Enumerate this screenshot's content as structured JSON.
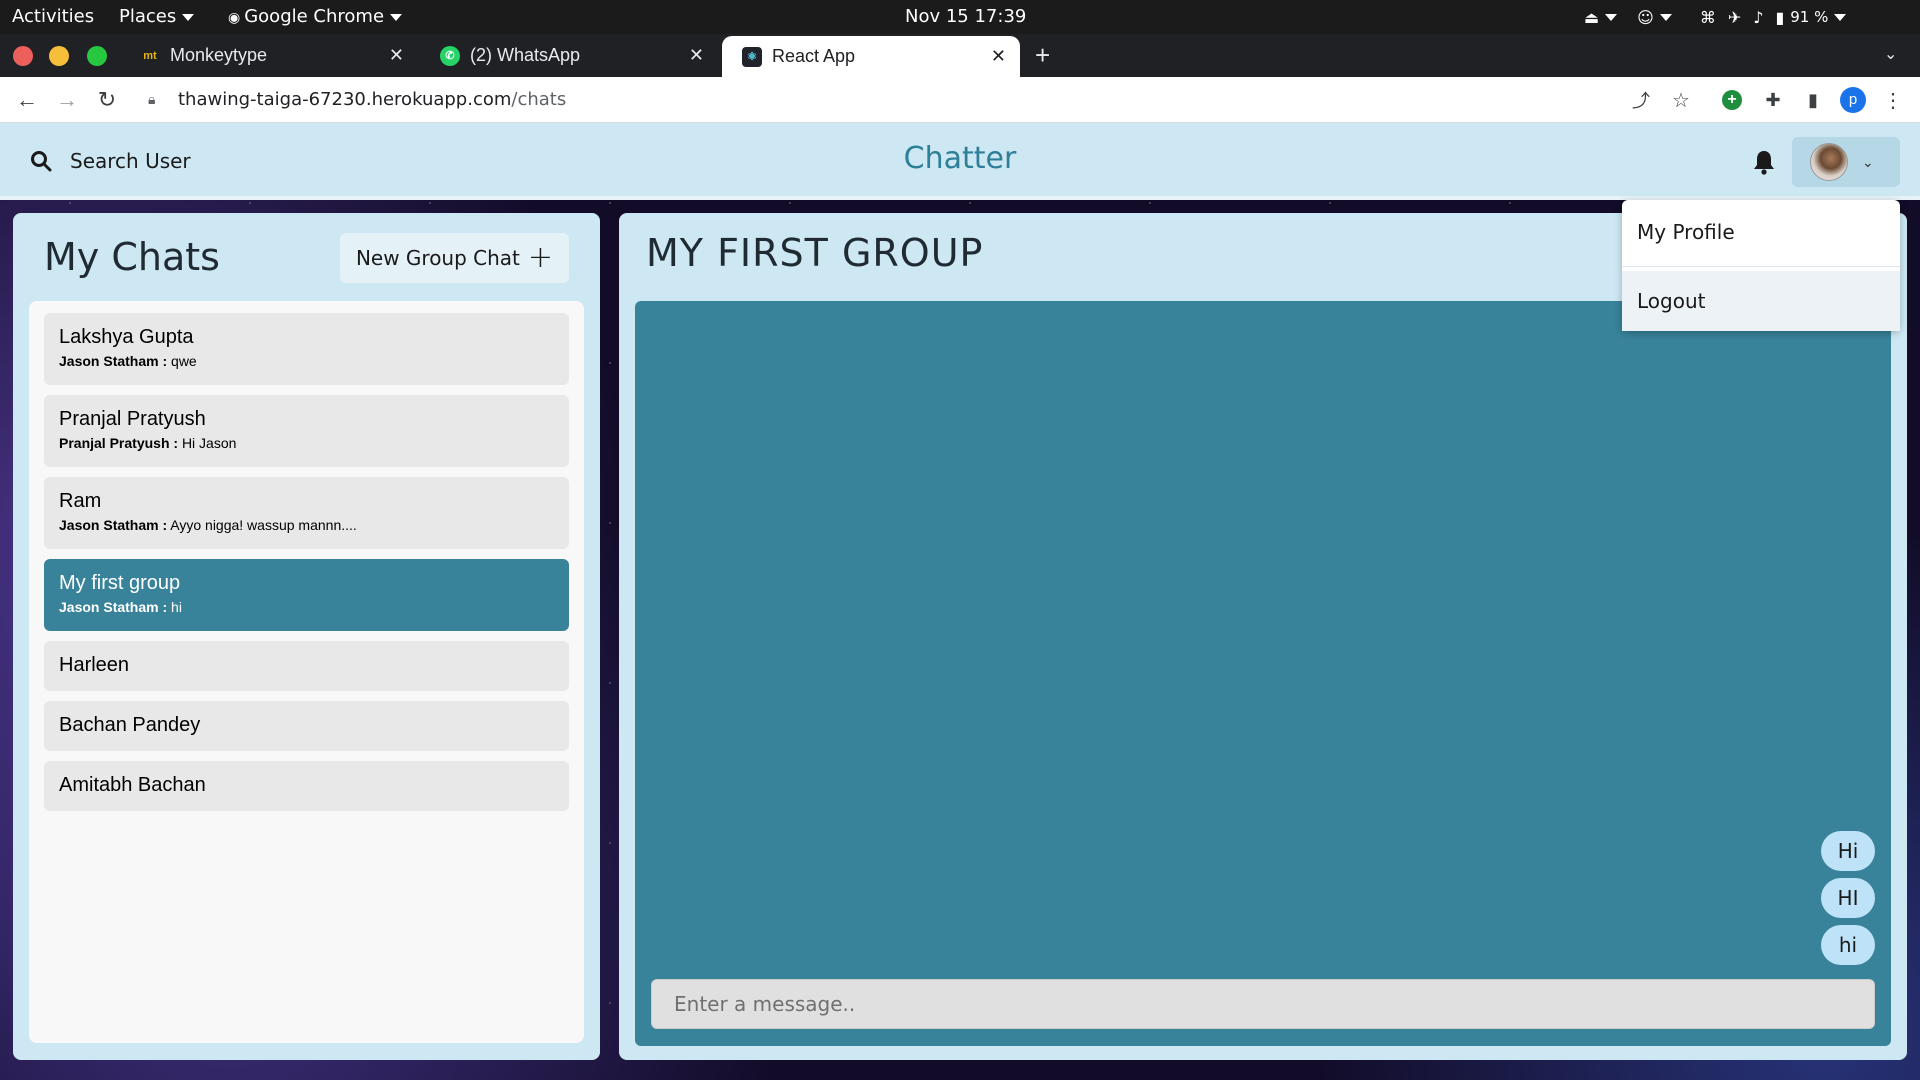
{
  "os_bar": {
    "activities": "Activities",
    "places": "Places",
    "app_menu": "Google Chrome",
    "datetime": "Nov 15  17:39",
    "battery": "91 %"
  },
  "browser": {
    "tabs": [
      {
        "label": "Monkeytype",
        "favicon": "mt"
      },
      {
        "label": "(2) WhatsApp"
      },
      {
        "label": "React App"
      }
    ],
    "url_host": "thawing-taiga-67230.herokuapp.com",
    "url_path": "/chats",
    "profile_initial": "p"
  },
  "header": {
    "search_label": "Search User",
    "title": "Chatter"
  },
  "my_chats": {
    "title": "My Chats",
    "new_group_label": "New Group Chat",
    "chats": [
      {
        "name": "Lakshya Gupta",
        "sender": "Jason Statham :",
        "message": "qwe"
      },
      {
        "name": "Pranjal Pratyush",
        "sender": "Pranjal Pratyush :",
        "message": "Hi Jason"
      },
      {
        "name": "Ram",
        "sender": "Jason Statham :",
        "message": "Ayyo nigga! wassup mannn...."
      },
      {
        "name": "My first group",
        "sender": "Jason Statham :",
        "message": "hi"
      },
      {
        "name": "Harleen"
      },
      {
        "name": "Bachan Pandey"
      },
      {
        "name": "Amitabh Bachan"
      }
    ]
  },
  "chat": {
    "title": "MY FIRST GROUP",
    "messages": [
      "Hi",
      "HI",
      "hi"
    ],
    "input_placeholder": "Enter a message.."
  },
  "profile_menu": {
    "items": [
      "My Profile",
      "Logout"
    ]
  },
  "colors": {
    "accent": "#38829a",
    "header_bg": "#cde8f3",
    "bubble": "#bee3f8"
  }
}
